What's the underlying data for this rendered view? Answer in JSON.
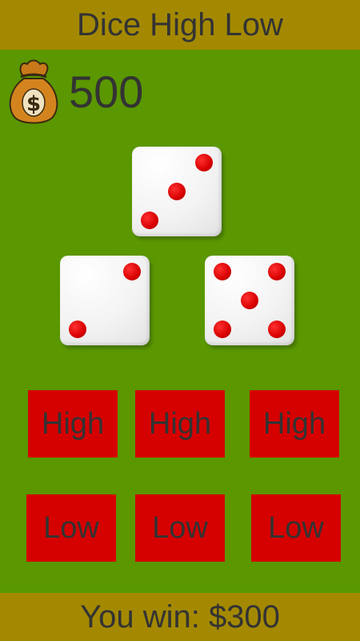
{
  "header": {
    "title": "Dice High Low"
  },
  "bank": {
    "icon": "money-bag-icon",
    "amount": "500"
  },
  "dice": [
    {
      "value": 3,
      "pips": [
        [
          0.8,
          0.18
        ],
        [
          0.5,
          0.5
        ],
        [
          0.2,
          0.82
        ]
      ]
    },
    {
      "value": 2,
      "pips": [
        [
          0.8,
          0.18
        ],
        [
          0.2,
          0.82
        ]
      ]
    },
    {
      "value": 5,
      "pips": [
        [
          0.2,
          0.18
        ],
        [
          0.8,
          0.18
        ],
        [
          0.5,
          0.5
        ],
        [
          0.2,
          0.82
        ],
        [
          0.8,
          0.82
        ]
      ]
    }
  ],
  "bets": {
    "high": [
      "High",
      "High",
      "High"
    ],
    "low": [
      "Low",
      "Low",
      "Low"
    ]
  },
  "footer": {
    "result": "You win: $300"
  },
  "colors": {
    "table": "#5a9700",
    "bar": "#a48900",
    "button": "#d50000",
    "pip": "#d80000"
  }
}
